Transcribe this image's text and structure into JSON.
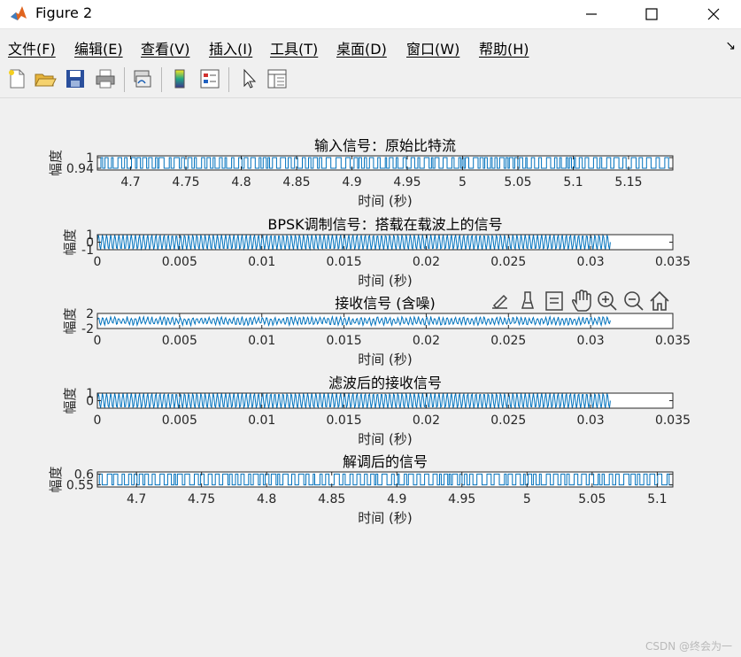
{
  "window": {
    "title": "Figure 2",
    "minimize_icon": "minimize-icon",
    "maximize_icon": "maximize-icon",
    "close_icon": "close-icon"
  },
  "menu": {
    "items": [
      "文件(F)",
      "编辑(E)",
      "查看(V)",
      "插入(I)",
      "工具(T)",
      "桌面(D)",
      "窗口(W)",
      "帮助(H)"
    ]
  },
  "toolbar": {
    "icons": [
      "new-figure-icon",
      "open-file-icon",
      "save-icon",
      "print-icon",
      "link-plot-icon",
      "colorbar-icon",
      "legend-icon",
      "pointer-icon",
      "property-inspector-icon"
    ]
  },
  "axes_toolbar": {
    "icons": [
      "edit-plot-icon",
      "brush-icon",
      "data-tip-icon",
      "pan-icon",
      "zoom-in-icon",
      "zoom-out-icon",
      "home-icon"
    ]
  },
  "colors": {
    "line": "#0072bd",
    "axis": "#262626",
    "background": "#f0f0f0",
    "plot_bg": "#ffffff"
  },
  "watermark": "CSDN @终会为一",
  "chart_data": [
    {
      "type": "line",
      "title": "输入信号：原始比特流",
      "xlabel": "时间 (秒)",
      "ylabel": "幅度",
      "x_ticks": [
        "4.7",
        "4.75",
        "4.8",
        "4.85",
        "4.9",
        "4.95",
        "5",
        "5.05",
        "5.1",
        "5.15"
      ],
      "y_ticks": [
        "0.94",
        "1"
      ],
      "xlim": [
        4.67,
        5.19
      ],
      "ylim": [
        0.93,
        1.01
      ],
      "series": [
        {
          "signal": "square-wave bit stream, dense transitions between 0.94 and 1"
        }
      ]
    },
    {
      "type": "line",
      "title": "BPSK调制信号：搭载在载波上的信号",
      "xlabel": "时间 (秒)",
      "ylabel": "幅度",
      "x_ticks": [
        "0",
        "0.005",
        "0.01",
        "0.015",
        "0.02",
        "0.025",
        "0.03",
        "0.035"
      ],
      "y_ticks": [
        "-1",
        "0",
        "1"
      ],
      "xlim": [
        0,
        0.035
      ],
      "ylim": [
        -1,
        1
      ],
      "series": [
        {
          "signal": "sinusoidal carrier with amplitude 1",
          "x_end": 0.0312
        }
      ]
    },
    {
      "type": "line",
      "title": "接收信号 (含噪)",
      "xlabel": "时间 (秒)",
      "ylabel": "幅度",
      "x_ticks": [
        "0",
        "0.005",
        "0.01",
        "0.015",
        "0.02",
        "0.025",
        "0.03",
        "0.035"
      ],
      "y_ticks": [
        "-2",
        "2"
      ],
      "xlim": [
        0,
        0.035
      ],
      "ylim": [
        -2,
        2
      ],
      "series": [
        {
          "signal": "noisy sinusoid, amplitude about 1",
          "x_end": 0.0312
        }
      ]
    },
    {
      "type": "line",
      "title": "滤波后的接收信号",
      "xlabel": "时间 (秒)",
      "ylabel": "幅度",
      "x_ticks": [
        "0",
        "0.005",
        "0.01",
        "0.015",
        "0.02",
        "0.025",
        "0.03",
        "0.035"
      ],
      "y_ticks": [
        "0",
        "1"
      ],
      "xlim": [
        0,
        0.035
      ],
      "ylim": [
        -1,
        1
      ],
      "series": [
        {
          "signal": "filtered sinusoid, amplitude about 1",
          "x_end": 0.0312
        }
      ]
    },
    {
      "type": "line",
      "title": "解调后的信号",
      "xlabel": "时间 (秒)",
      "ylabel": "幅度",
      "x_ticks": [
        "4.7",
        "4.75",
        "4.8",
        "4.85",
        "4.9",
        "4.95",
        "5",
        "5.05",
        "5.1"
      ],
      "y_ticks": [
        "0.55",
        "0.6"
      ],
      "xlim": [
        4.67,
        5.112
      ],
      "ylim": [
        0.54,
        0.61
      ],
      "series": [
        {
          "signal": "square-wave demodulated bits, dense transitions between 0.55 and 0.6"
        }
      ]
    }
  ]
}
